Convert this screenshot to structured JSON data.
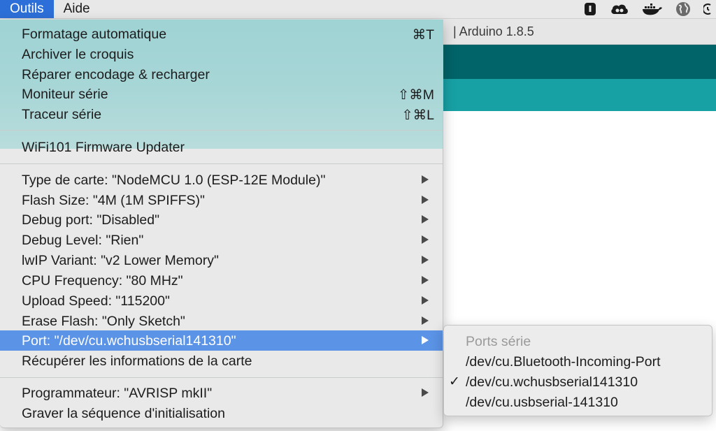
{
  "menubar": {
    "items": [
      "Outils",
      "Aide"
    ],
    "tray_icons": [
      "lastpass-icon",
      "creative-cloud-icon",
      "docker-icon",
      "globe-icon",
      "clock-icon"
    ]
  },
  "window": {
    "title": "| Arduino 1.8.5"
  },
  "menu": {
    "items": [
      {
        "label": "Formatage automatique",
        "shortcut": "⌘T"
      },
      {
        "label": "Archiver le croquis",
        "shortcut": ""
      },
      {
        "label": "Réparer encodage & recharger",
        "shortcut": ""
      },
      {
        "label": "Moniteur série",
        "shortcut": "⇧⌘M"
      },
      {
        "label": "Traceur série",
        "shortcut": "⇧⌘L"
      },
      {
        "label": "WiFi101 Firmware Updater",
        "shortcut": ""
      },
      {
        "label": "Type de carte: \"NodeMCU 1.0 (ESP-12E Module)\"",
        "submenu": true
      },
      {
        "label": "Flash Size: \"4M (1M SPIFFS)\"",
        "submenu": true
      },
      {
        "label": "Debug port: \"Disabled\"",
        "submenu": true
      },
      {
        "label": "Debug Level: \"Rien\"",
        "submenu": true
      },
      {
        "label": "lwIP Variant: \"v2 Lower Memory\"",
        "submenu": true
      },
      {
        "label": "CPU Frequency: \"80 MHz\"",
        "submenu": true
      },
      {
        "label": "Upload Speed: \"115200\"",
        "submenu": true
      },
      {
        "label": "Erase Flash: \"Only Sketch\"",
        "submenu": true
      },
      {
        "label": "Port: \"/dev/cu.wchusbserial141310\"",
        "submenu": true,
        "highlighted": true
      },
      {
        "label": "Récupérer les informations de la carte",
        "shortcut": ""
      },
      {
        "label": "Programmateur: \"AVRISP mkII\"",
        "submenu": true
      },
      {
        "label": "Graver la séquence d'initialisation",
        "shortcut": ""
      }
    ]
  },
  "port_submenu": {
    "header": "Ports série",
    "items": [
      {
        "label": "/dev/cu.Bluetooth-Incoming-Port",
        "checked": false
      },
      {
        "label": "/dev/cu.wchusbserial141310",
        "checked": true,
        "check_mark": "✓"
      },
      {
        "label": "/dev/cu.usbserial-141310",
        "checked": false
      }
    ]
  },
  "colors": {
    "highlight": "#5b93e6",
    "menubar_active": "#2d6fd8",
    "arduino_dark_teal": "#006468",
    "arduino_teal": "#17a1a5"
  }
}
